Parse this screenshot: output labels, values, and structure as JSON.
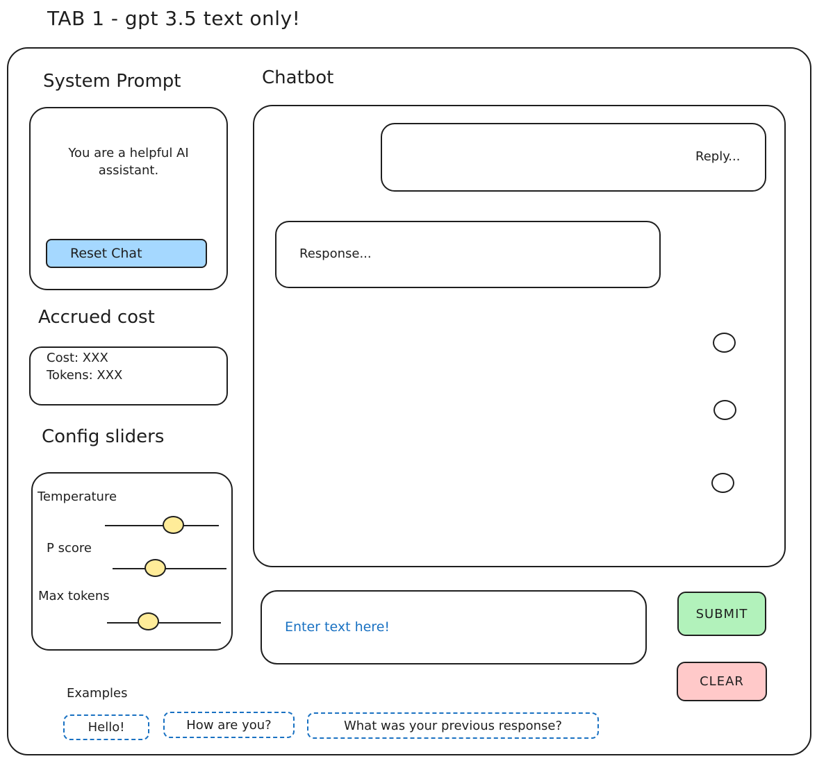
{
  "page_title": "TAB 1 - gpt 3.5 text only!",
  "system_prompt": {
    "heading": "System Prompt",
    "text": "You are a helpful AI assistant.",
    "reset_label": "Reset Chat"
  },
  "cost": {
    "heading": "Accrued cost",
    "cost_line": "Cost: XXX",
    "tokens_line": "Tokens: XXX"
  },
  "config": {
    "heading": "Config sliders",
    "sliders": [
      {
        "label": "Temperature",
        "value": 0.6
      },
      {
        "label": "P score",
        "value": 0.37
      },
      {
        "label": "Max tokens",
        "value": 0.36
      }
    ]
  },
  "chatbot": {
    "heading": "Chatbot",
    "reply": "Reply...",
    "response": "Response..."
  },
  "input": {
    "placeholder": "Enter text here!"
  },
  "actions": {
    "submit_label": "SUBMIT",
    "clear_label": "CLEAR"
  },
  "examples": {
    "heading": "Examples",
    "items": [
      "Hello!",
      "How are you?",
      "What was your previous response?"
    ]
  },
  "colors": {
    "reset_button": "#a5d8ff",
    "slider_knob": "#ffec99",
    "submit_button": "#b2f2bb",
    "clear_button": "#ffc9c9",
    "placeholder_text": "#1971c2",
    "example_border": "#1971c2"
  }
}
